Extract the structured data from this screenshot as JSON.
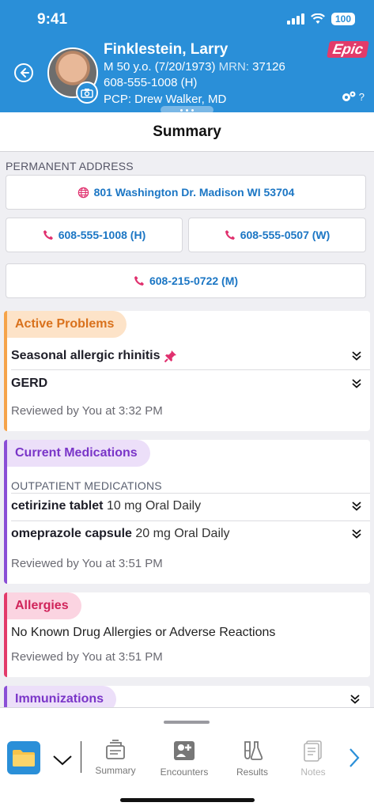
{
  "status": {
    "time": "9:41",
    "battery": "100"
  },
  "patient": {
    "name": "Finklestein, Larry",
    "demographics": "M 50 y.o. (7/20/1973)",
    "mrn_label": "MRN:",
    "mrn": "37126",
    "phone": "608-555-1008 (H)",
    "pcp": "PCP: Drew Walker, MD"
  },
  "brand": {
    "logo_text": "Epic",
    "help": "?"
  },
  "page_title": "Summary",
  "address": {
    "label": "PERMANENT ADDRESS",
    "street": "801 Washington Dr. Madison WI 53704",
    "phones": [
      "608-555-1008 (H)",
      "608-555-0507 (W)",
      "608-215-0722 (M)"
    ]
  },
  "active_problems": {
    "title": "Active Problems",
    "items": [
      "Seasonal allergic rhinitis",
      "GERD"
    ],
    "reviewed": "Reviewed by You at 3:32 PM"
  },
  "current_medications": {
    "title": "Current Medications",
    "subheading": "OUTPATIENT MEDICATIONS",
    "items": [
      {
        "name": "cetirizine tablet",
        "detail": "10 mg Oral Daily"
      },
      {
        "name": "omeprazole capsule",
        "detail": "20 mg Oral Daily"
      }
    ],
    "reviewed": "Reviewed by You at 3:51 PM"
  },
  "allergies": {
    "title": "Allergies",
    "text": "No Known Drug Allergies or Adverse Reactions",
    "reviewed": "Reviewed by You at 3:51 PM"
  },
  "immunizations": {
    "title": "Immunizations"
  },
  "bottom_nav": {
    "tabs": [
      "Summary",
      "Encounters",
      "Results",
      "Notes"
    ]
  },
  "colors": {
    "header_blue": "#2a8fd8",
    "problems_accent": "#f5a34a",
    "medications_accent": "#8a4fd6",
    "allergies_accent": "#e23b6a",
    "link_blue": "#1b76c4",
    "phone_pink": "#e0306e"
  }
}
